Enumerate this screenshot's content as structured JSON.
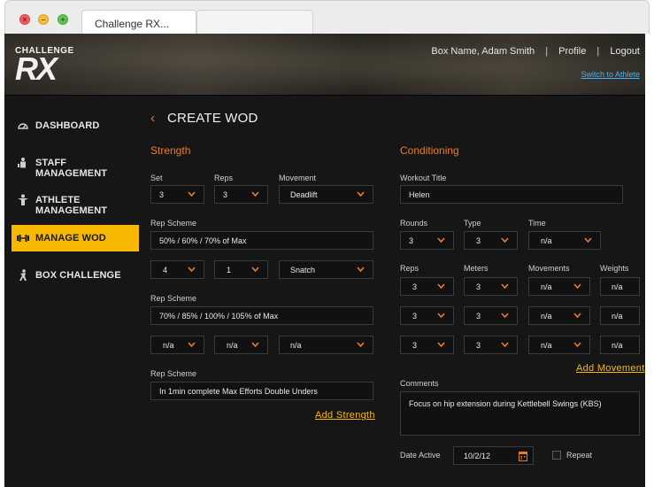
{
  "browser": {
    "tab_title": "Challenge RX..."
  },
  "header": {
    "logo_top": "CHALLENGE",
    "logo_main": "RX",
    "box_user": "Box Name,  Adam Smith",
    "profile_label": "Profile",
    "logout_label": "Logout",
    "switch_label": "Switch to Athlete"
  },
  "sidebar": {
    "items": [
      {
        "label": "DASHBOARD",
        "icon": "dashboard-icon"
      },
      {
        "label": "STAFF MANAGEMENT",
        "icon": "staff-icon"
      },
      {
        "label": "ATHLETE MANAGEMENT",
        "icon": "athlete-icon"
      },
      {
        "label": "MANAGE WOD",
        "icon": "barbell-icon"
      },
      {
        "label": "BOX CHALLENGE",
        "icon": "challenge-icon"
      }
    ],
    "active_index": 3,
    "active_color": "#f7b900"
  },
  "page": {
    "title": "CREATE WOD"
  },
  "strength": {
    "title": "Strength",
    "labels": {
      "set": "Set",
      "reps": "Reps",
      "movement": "Movement",
      "rep_scheme": "Rep Scheme"
    },
    "rows": [
      {
        "set": "3",
        "reps": "3",
        "movement": "Deadlift",
        "scheme": "50% / 60% / 70%  of Max"
      },
      {
        "set": "4",
        "reps": "1",
        "movement": "Snatch",
        "scheme": "70% / 85% / 100% / 105%  of Max"
      },
      {
        "set": "n/a",
        "reps": "n/a",
        "movement": "n/a",
        "scheme": "In 1min complete Max Efforts Double Unders"
      }
    ],
    "add_label": "Add Strength"
  },
  "conditioning": {
    "title": "Conditioning",
    "labels": {
      "workout_title": "Workout Title",
      "rounds": "Rounds",
      "type": "Type",
      "time": "Time",
      "reps": "Reps",
      "meters": "Meters",
      "movements": "Movements",
      "weights": "Weights",
      "comments": "Comments",
      "date_active": "Date Active",
      "repeat": "Repeat"
    },
    "workout_title": "Helen",
    "rounds": "3",
    "type": "3",
    "time": "n/a",
    "movement_rows": [
      {
        "reps": "3",
        "meters": "3",
        "movements": "n/a",
        "weights": "n/a"
      },
      {
        "reps": "3",
        "meters": "3",
        "movements": "n/a",
        "weights": "n/a"
      },
      {
        "reps": "3",
        "meters": "3",
        "movements": "n/a",
        "weights": "n/a"
      }
    ],
    "add_label": "Add Movement",
    "comments": "Focus on hip extension during Kettlebell Swings (KBS)",
    "date_active": "10/2/12"
  },
  "colors": {
    "accent": "#f07a22",
    "link": "#f7b900",
    "background": "#161616"
  }
}
